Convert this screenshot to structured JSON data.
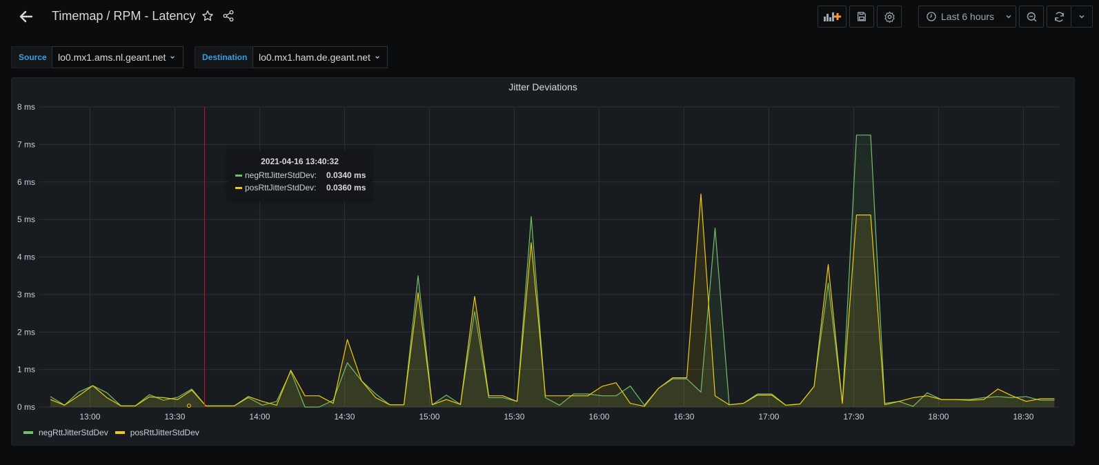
{
  "header": {
    "title": "Timemap / RPM - Latency",
    "time_range": "Last 6 hours"
  },
  "variables": {
    "source_label": "Source",
    "source_value": "lo0.mx1.ams.nl.geant.net",
    "destination_label": "Destination",
    "destination_value": "lo0.mx1.ham.de.geant.net"
  },
  "icons": {
    "back": "arrow-left-icon",
    "star": "star-icon",
    "share": "share-icon",
    "add_panel": "add-panel-icon",
    "save": "save-icon",
    "settings": "gear-icon",
    "clock": "clock-icon",
    "zoom_out": "zoom-out-icon",
    "refresh": "refresh-icon",
    "chevron": "chevron-down-icon"
  },
  "colors": {
    "neg": "#73bf69",
    "pos": "#f2cc0c",
    "cursor": "#c4162a",
    "accent": "#33a2e5"
  },
  "tooltip": {
    "time": "2021-04-16 13:40:32",
    "rows": [
      {
        "name": "negRttJitterStdDev:",
        "value": "0.0340 ms"
      },
      {
        "name": "posRttJitterStdDev:",
        "value": "0.0360 ms"
      }
    ]
  },
  "legend": [
    "negRttJitterStdDev",
    "posRttJitterStdDev"
  ],
  "chart_data": {
    "type": "area",
    "title": "Jitter Deviations",
    "xlabel": "",
    "ylabel": "",
    "x_start": "12:46",
    "x_step_minutes": 5,
    "x_ticks": [
      "13:00",
      "13:30",
      "14:00",
      "14:30",
      "15:00",
      "15:30",
      "16:00",
      "16:30",
      "17:00",
      "17:30",
      "18:00",
      "18:30"
    ],
    "y_ticks": [
      "0 ms",
      "1 ms",
      "2 ms",
      "3 ms",
      "4 ms",
      "5 ms",
      "6 ms",
      "7 ms",
      "8 ms"
    ],
    "ylim": [
      0,
      8
    ],
    "xlim": [
      "12:46",
      "18:46"
    ],
    "grid": true,
    "legend_position": "bottom-left",
    "cursor_time": "13:40:32",
    "series": [
      {
        "name": "negRttJitterStdDev",
        "values": [
          0.28,
          0.05,
          0.4,
          0.57,
          0.38,
          0.03,
          0.03,
          0.33,
          0.18,
          0.26,
          0.48,
          0.03,
          0.03,
          0.03,
          0.25,
          0.05,
          0.15,
          0.95,
          0.0,
          0.0,
          0.18,
          1.18,
          0.7,
          0.35,
          0.06,
          0.06,
          3.5,
          0.06,
          0.32,
          0.07,
          2.55,
          0.25,
          0.25,
          0.15,
          5.08,
          0.25,
          0.05,
          0.35,
          0.35,
          0.3,
          0.3,
          0.56,
          0.05,
          0.5,
          0.75,
          0.75,
          0.4,
          4.77,
          0.06,
          0.1,
          0.35,
          0.35,
          0.05,
          0.08,
          0.55,
          3.3,
          0.1,
          7.25,
          7.25,
          0.1,
          0.15,
          0.02,
          0.38,
          0.2,
          0.2,
          0.2,
          0.25,
          0.28,
          0.25,
          0.28,
          0.18,
          0.18
        ],
        "fill": true
      },
      {
        "name": "posRttJitterStdDev",
        "values": [
          0.2,
          0.05,
          0.3,
          0.57,
          0.25,
          0.03,
          0.03,
          0.27,
          0.25,
          0.2,
          0.45,
          0.03,
          0.03,
          0.03,
          0.28,
          0.15,
          0.05,
          0.98,
          0.3,
          0.3,
          0.1,
          1.8,
          0.7,
          0.25,
          0.06,
          0.06,
          3.05,
          0.06,
          0.2,
          0.07,
          2.95,
          0.3,
          0.3,
          0.15,
          4.38,
          0.3,
          0.3,
          0.3,
          0.3,
          0.55,
          0.65,
          0.1,
          0.02,
          0.5,
          0.78,
          0.78,
          5.68,
          0.3,
          0.06,
          0.1,
          0.32,
          0.32,
          0.05,
          0.08,
          0.55,
          3.8,
          0.1,
          5.12,
          5.12,
          0.06,
          0.15,
          0.25,
          0.3,
          0.2,
          0.2,
          0.18,
          0.2,
          0.48,
          0.3,
          0.15,
          0.22,
          0.22
        ],
        "fill": true
      }
    ]
  }
}
